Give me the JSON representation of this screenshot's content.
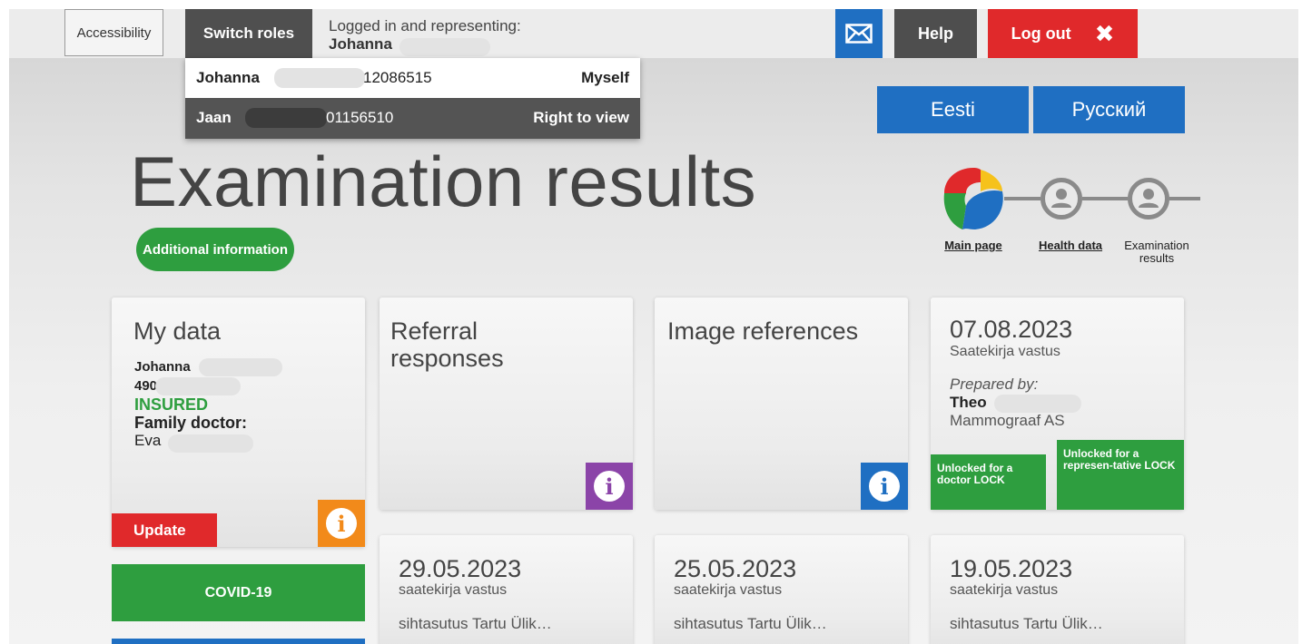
{
  "topbar": {
    "accessibility_label": "Accessibility",
    "switch_roles_label": "Switch roles",
    "logged_in_text": "Logged in and representing:",
    "representing_name": "Johanna",
    "mail_icon": "envelope-icon",
    "help_label": "Help",
    "logout_label": "Log out",
    "logout_icon_glyph": "✖"
  },
  "roles_dropdown": {
    "items": [
      {
        "name": "Johanna",
        "code": "12086515",
        "role": "Myself"
      },
      {
        "name": "Jaan",
        "code": "01156510",
        "role": "Right to view"
      }
    ]
  },
  "languages": [
    {
      "label": "Eesti"
    },
    {
      "label": "Русский"
    }
  ],
  "page": {
    "title": "Examination results",
    "additional_info_label": "Additional information"
  },
  "breadcrumb": {
    "items": [
      {
        "label": "Main page"
      },
      {
        "label": "Health data"
      },
      {
        "label": "Examination results"
      }
    ]
  },
  "my_data": {
    "title": "My data",
    "name": "Johanna",
    "id_prefix": "490",
    "status": "INSURED",
    "family_doctor_label": "Family doctor:",
    "family_doctor_name": "Eva",
    "update_label": "Update",
    "covid_label": "COVID-19"
  },
  "referral_card": {
    "title": "Referral responses"
  },
  "image_card": {
    "title": "Image references"
  },
  "result_card": {
    "date": "07.08.2023",
    "type": "Saatekirja vastus",
    "prepared_by_label": "Prepared by:",
    "prepared_by_name": "Theo",
    "organization": "Mammograaf AS",
    "lock_doctor_label": "Unlocked for a doctor LOCK",
    "lock_rep_label": "Unlocked for a represen-tative LOCK"
  },
  "lower_cards": [
    {
      "date": "29.05.2023",
      "type": "saatekirja vastus",
      "org": "sihtasutus Tartu Ülik…"
    },
    {
      "date": "25.05.2023",
      "type": "saatekirja vastus",
      "org": "sihtasutus Tartu Ülik…"
    },
    {
      "date": "19.05.2023",
      "type": "saatekirja vastus",
      "org": "sihtasutus Tartu Ülik…"
    }
  ],
  "colors": {
    "blue": "#1f6fc2",
    "red": "#e0292b",
    "green": "#2e9e3f",
    "purple": "#8b44a8",
    "orange": "#f28a1a",
    "dark_gray": "#4f4f4f"
  }
}
